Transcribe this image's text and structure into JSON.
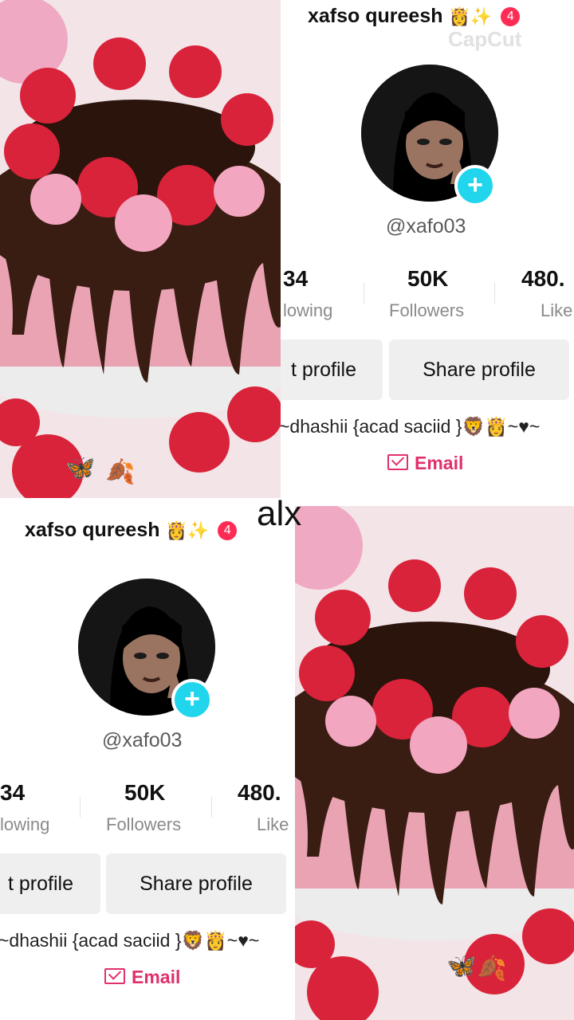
{
  "overlay_text": "alx",
  "watermark": "CapCut",
  "profile": {
    "display_name": "xafso qureesh",
    "name_emojis": "👸✨",
    "badge_count": "4",
    "handle": "@xafo03",
    "stats": [
      {
        "value": "34",
        "label": "lowing"
      },
      {
        "value": "50K",
        "label": "Followers"
      },
      {
        "value": "480.",
        "label": "Like"
      }
    ],
    "buttons": {
      "edit": "t profile",
      "share": "Share profile"
    },
    "bio": "~dhashii {acad saciid }🦁👸~♥~",
    "email_label": "Email"
  },
  "decorations": {
    "butterfly": "🦋",
    "leaf": "🍂"
  },
  "colors": {
    "accent_pink": "#fe2c55",
    "plus_cyan": "#20d5ec",
    "email_pink": "#e1306c"
  }
}
